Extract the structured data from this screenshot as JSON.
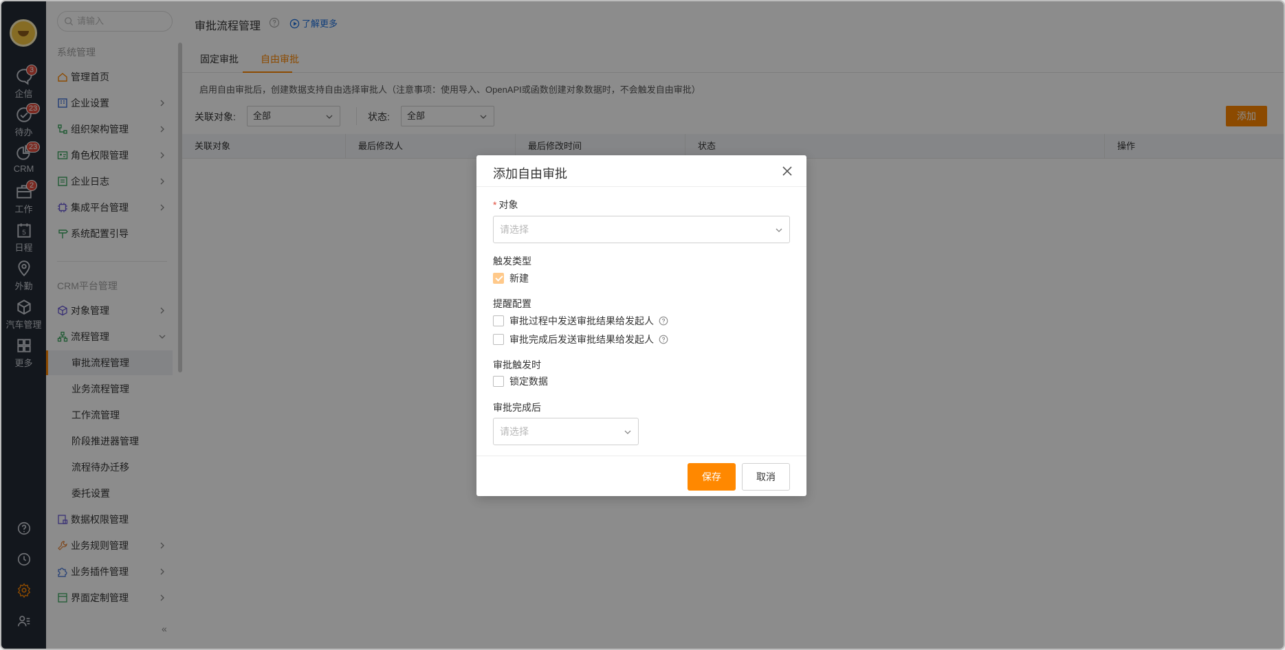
{
  "rail": {
    "items": [
      {
        "label": "企信",
        "badge": "3",
        "icon": "chat-icon"
      },
      {
        "label": "待办",
        "badge": "23",
        "icon": "check-circle-icon"
      },
      {
        "label": "CRM",
        "badge": "23",
        "icon": "pie-chart-icon"
      },
      {
        "label": "工作",
        "badge": "2",
        "icon": "briefcase-icon"
      },
      {
        "label": "日程",
        "badge": "",
        "icon": "calendar-icon",
        "calendar_day": "5"
      },
      {
        "label": "外勤",
        "badge": "",
        "icon": "location-pin-icon"
      },
      {
        "label": "汽车管理",
        "badge": "",
        "icon": "cube-icon"
      },
      {
        "label": "更多",
        "badge": "",
        "icon": "grid-icon"
      }
    ],
    "bottom_icons": [
      "help-icon",
      "clock-icon",
      "settings-icon",
      "user-list-icon"
    ]
  },
  "menu": {
    "search_placeholder": "请输入",
    "group_system": "系统管理",
    "items_system": [
      {
        "label": "管理首页",
        "icon": "home-icon"
      },
      {
        "label": "企业设置",
        "icon": "building-icon"
      },
      {
        "label": "组织架构管理",
        "icon": "org-tree-icon"
      },
      {
        "label": "角色权限管理",
        "icon": "id-card-icon"
      },
      {
        "label": "企业日志",
        "icon": "log-icon"
      },
      {
        "label": "集成平台管理",
        "icon": "chip-icon"
      },
      {
        "label": "系统配置引导",
        "icon": "signpost-icon"
      }
    ],
    "group_crm": "CRM平台管理",
    "items_crm": [
      {
        "label": "对象管理",
        "icon": "cube-icon"
      },
      {
        "label": "流程管理",
        "icon": "flow-icon"
      }
    ],
    "sub_items": [
      "审批流程管理",
      "业务流程管理",
      "工作流管理",
      "阶段推进器管理",
      "流程待办迁移",
      "委托设置"
    ],
    "items_crm_after": [
      {
        "label": "数据权限管理",
        "icon": "data-lock-icon"
      },
      {
        "label": "业务规则管理",
        "icon": "wrench-icon"
      },
      {
        "label": "业务插件管理",
        "icon": "puzzle-icon"
      },
      {
        "label": "界面定制管理",
        "icon": "layout-icon"
      }
    ],
    "collapse": "«"
  },
  "main": {
    "title": "审批流程管理",
    "learn_more": "了解更多",
    "tabs": [
      "固定审批",
      "自由审批"
    ],
    "active_tab": "自由审批",
    "notice": "启用自由审批后，创建数据支持自由选择审批人（注意事项：使用导入、OpenAPI或函数创建对象数据时，不会触发自由审批）",
    "filter_object_label": "关联对象:",
    "filter_object_value": "全部",
    "filter_status_label": "状态:",
    "filter_status_value": "全部",
    "add_button": "添加",
    "columns": [
      "关联对象",
      "最后修改人",
      "最后修改时间",
      "状态",
      "操作"
    ]
  },
  "modal": {
    "title": "添加自由审批",
    "object_label": "对象",
    "object_placeholder": "请选择",
    "trigger_label": "触发类型",
    "trigger_option": "新建",
    "trigger_checked": true,
    "remind_label": "提醒配置",
    "remind_option1": "审批过程中发送审批结果给发起人",
    "remind_option2": "审批完成后发送审批结果给发起人",
    "on_trigger_label": "审批触发时",
    "lock_option": "锁定数据",
    "after_label": "审批完成后",
    "after_placeholder": "请选择",
    "save": "保存",
    "cancel": "取消"
  },
  "colors": {
    "accent": "#ff8800",
    "rail_bg": "#232a36",
    "link": "#1c6fde",
    "badge": "#e04c3c"
  }
}
